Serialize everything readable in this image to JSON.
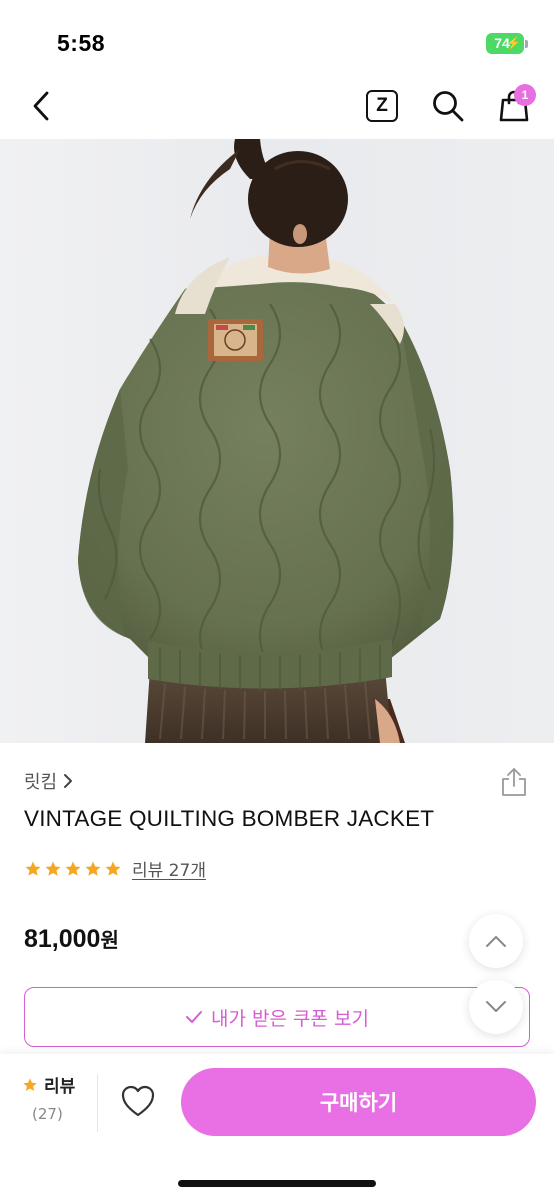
{
  "status_bar": {
    "time": "5:58",
    "battery": "74",
    "battery_icon": "charging-bolt-icon",
    "colors": {
      "battery": "#4cd964"
    }
  },
  "nav": {
    "back_icon": "chevron-left-icon",
    "z_label": "Z",
    "search_icon": "search-icon",
    "cart_icon": "shopping-bag-icon",
    "cart_count": "1"
  },
  "product": {
    "brand": "릿킴",
    "name": "VINTAGE QUILTING BOMBER JACKET",
    "rating": 5,
    "review_link": "리뷰 27개",
    "price_value": "81,000",
    "price_unit": "원"
  },
  "coupon": {
    "label": "내가 받은 쿠폰 보기"
  },
  "bottom": {
    "review_label": "리뷰",
    "review_count": "(27)",
    "buy_label": "구매하기"
  },
  "colors": {
    "accent": "#e96fe4",
    "accent_text": "#d65ed3",
    "star": "#f5a623"
  }
}
